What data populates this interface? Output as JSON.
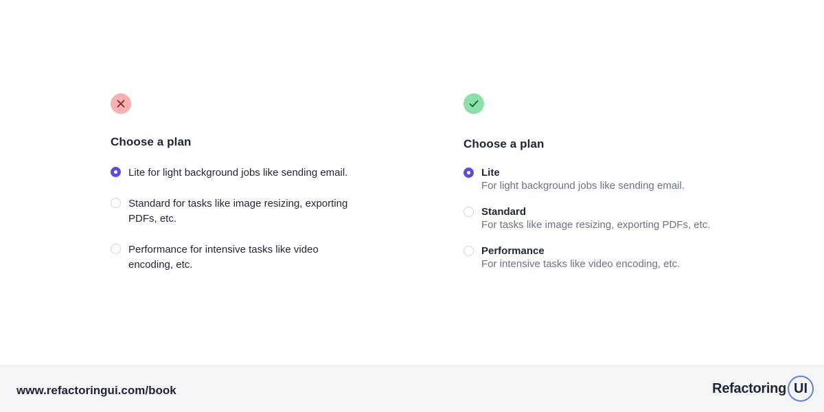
{
  "bad_example": {
    "status_icon": "x-icon",
    "status_color": "#f8b1b1",
    "title": "Choose a plan",
    "options": [
      {
        "text": "Lite for light background jobs like sending email.",
        "selected": true
      },
      {
        "text": "Standard for tasks like image resizing, exporting PDFs, etc.",
        "selected": false
      },
      {
        "text": "Performance for intensive tasks like video encoding, etc.",
        "selected": false
      }
    ]
  },
  "good_example": {
    "status_icon": "check-icon",
    "status_color": "#89e0a8",
    "title": "Choose a plan",
    "options": [
      {
        "name": "Lite",
        "description": "For light background jobs like sending email.",
        "selected": true
      },
      {
        "name": "Standard",
        "description": "For tasks like image resizing, exporting PDFs, etc.",
        "selected": false
      },
      {
        "name": "Performance",
        "description": "For intensive tasks like video encoding, etc.",
        "selected": false
      }
    ]
  },
  "footer": {
    "url": "www.refactoringui.com/book",
    "logo_word": "Refactoring",
    "logo_badge": "UI"
  },
  "colors": {
    "accent": "#5a4fd9",
    "text": "#1f2433",
    "muted": "#6b7280"
  }
}
